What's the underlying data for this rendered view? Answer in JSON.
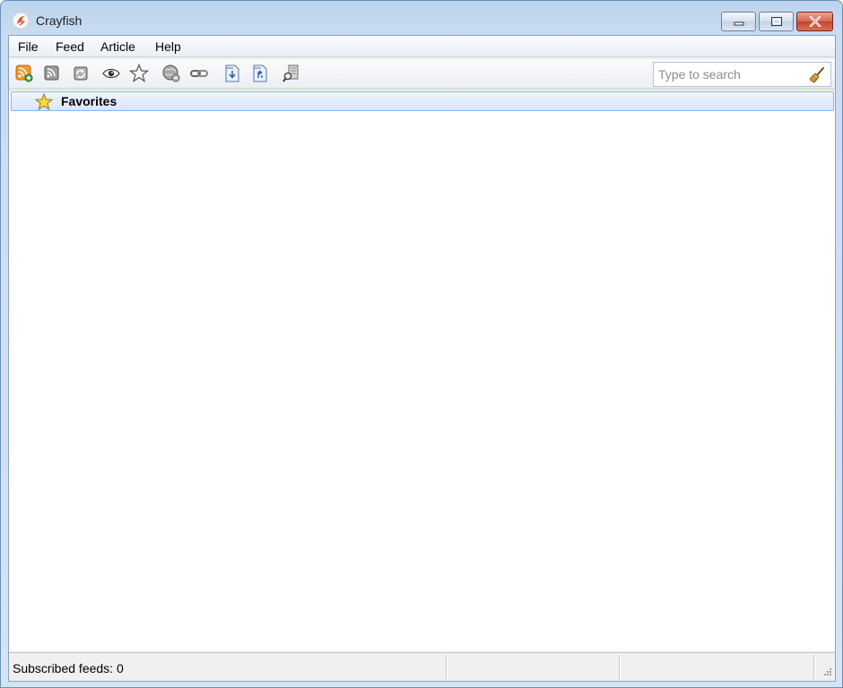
{
  "window": {
    "title": "Crayfish"
  },
  "menu": {
    "items": [
      {
        "label": "File"
      },
      {
        "label": "Feed"
      },
      {
        "label": "Article"
      },
      {
        "label": "Help"
      }
    ]
  },
  "toolbar": {
    "buttons": [
      {
        "icon": "add-feed-icon"
      },
      {
        "icon": "feed-icon"
      },
      {
        "icon": "refresh-icon"
      },
      {
        "icon": "eye-icon"
      },
      {
        "icon": "star-icon"
      },
      {
        "icon": "globe-icon"
      },
      {
        "icon": "link-icon"
      },
      {
        "icon": "import-icon"
      },
      {
        "icon": "export-icon"
      },
      {
        "icon": "document-search-icon"
      }
    ],
    "search": {
      "placeholder": "Type to search",
      "value": ""
    }
  },
  "tree": {
    "favorites_label": "Favorites"
  },
  "status": {
    "text": "Subscribed feeds: 0"
  },
  "colors": {
    "selection": "#d7e7fa",
    "selection_border": "#8fb2df",
    "rss_orange": "#f39a2b",
    "close_red": "#c6432a"
  }
}
